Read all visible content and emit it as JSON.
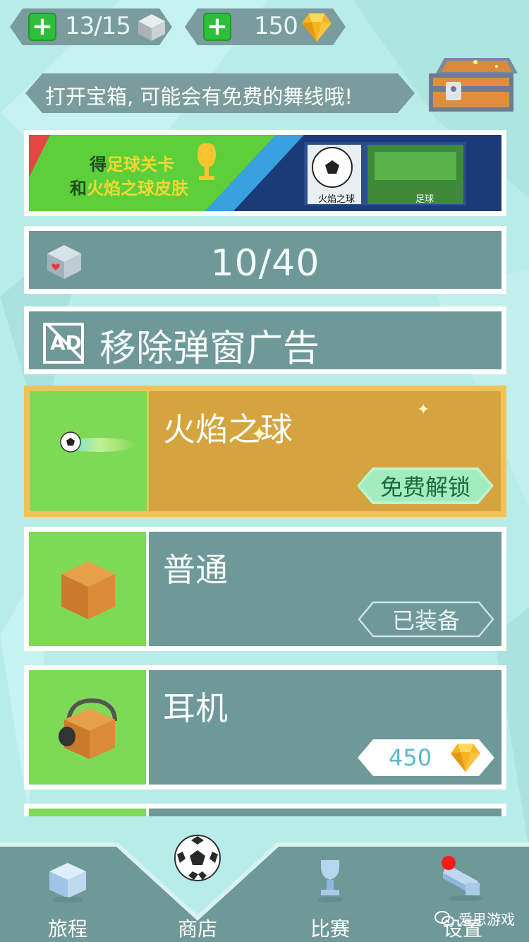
{
  "topbar": {
    "energy": {
      "value": "13/15",
      "icon": "gray-cube-icon"
    },
    "coins": {
      "value": "150",
      "icon": "gold-gem-icon"
    }
  },
  "tip": {
    "text": "打开宝箱, 可能会有免费的舞线哦!",
    "icon": "treasure-chest-icon"
  },
  "promo": {
    "line1_prefix": "得",
    "line1_highlight": "足球关卡",
    "line2_prefix": "和",
    "line2_highlight": "火焰之球皮肤",
    "skin_caption": "火焰之球",
    "level_caption": "足球"
  },
  "counter": {
    "value": "10/40",
    "icon": "heart-cube-icon"
  },
  "remove_ads": {
    "label": "移除弹窗广告",
    "icon": "no-ad-icon",
    "icon_text": "AD"
  },
  "skins": [
    {
      "name": "火焰之球",
      "tag": "免费解锁",
      "state": "free"
    },
    {
      "name": "普通",
      "tag": "已装备",
      "state": "equipped"
    },
    {
      "name": "耳机",
      "tag": "450",
      "state": "price"
    }
  ],
  "nav": {
    "items": [
      {
        "label": "旅程",
        "icon": "journey-icon"
      },
      {
        "label": "商店",
        "icon": "soccer-ball-icon"
      },
      {
        "label": "比赛",
        "icon": "trophy-icon"
      },
      {
        "label": "设置",
        "icon": "settings-icon"
      }
    ]
  },
  "watermark": {
    "text": "爱思游戏"
  },
  "colors": {
    "background": "#b8ece8",
    "panel": "#6f9898",
    "highlight_gold": "#d5a43e",
    "thumb_green": "#7ed957",
    "plus_green": "#2dbf3a"
  }
}
